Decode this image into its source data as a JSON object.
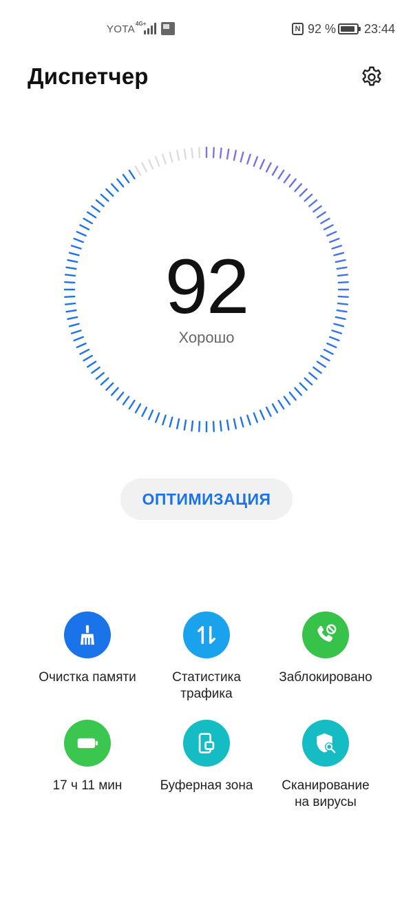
{
  "status_bar": {
    "carrier": "YOTA",
    "network": "4G+",
    "battery_percent": "92 %",
    "battery_level": 0.92,
    "time": "23:44",
    "nfc_icon": "nfc-icon"
  },
  "header": {
    "title": "Диспетчер",
    "settings_icon": "gear-icon"
  },
  "gauge": {
    "score": "92",
    "status": "Хорошо",
    "fill_fraction": 0.92,
    "colors": {
      "start": "#1a73e8",
      "end": "#8a6fe8",
      "empty": "#dcdcdc"
    }
  },
  "optimize": {
    "label": "ОПТИМИЗАЦИЯ",
    "color": "#1a73e8"
  },
  "tiles": [
    {
      "label": "Очистка памяти",
      "icon": "broom-icon",
      "color": "#1a73e8"
    },
    {
      "label": "Статистика\nтрафика",
      "icon": "up-down-arrows-icon",
      "color": "#1aa3ec"
    },
    {
      "label": "Заблокировано",
      "icon": "phone-blocked-icon",
      "color": "#37c34a"
    },
    {
      "label": "17 ч 11 мин",
      "icon": "battery-icon",
      "color": "#3ac64f"
    },
    {
      "label": "Буферная зона",
      "icon": "phone-copy-icon",
      "color": "#16bcc4"
    },
    {
      "label": "Сканирование\nна вирусы",
      "icon": "shield-search-icon",
      "color": "#16bcc4"
    }
  ]
}
